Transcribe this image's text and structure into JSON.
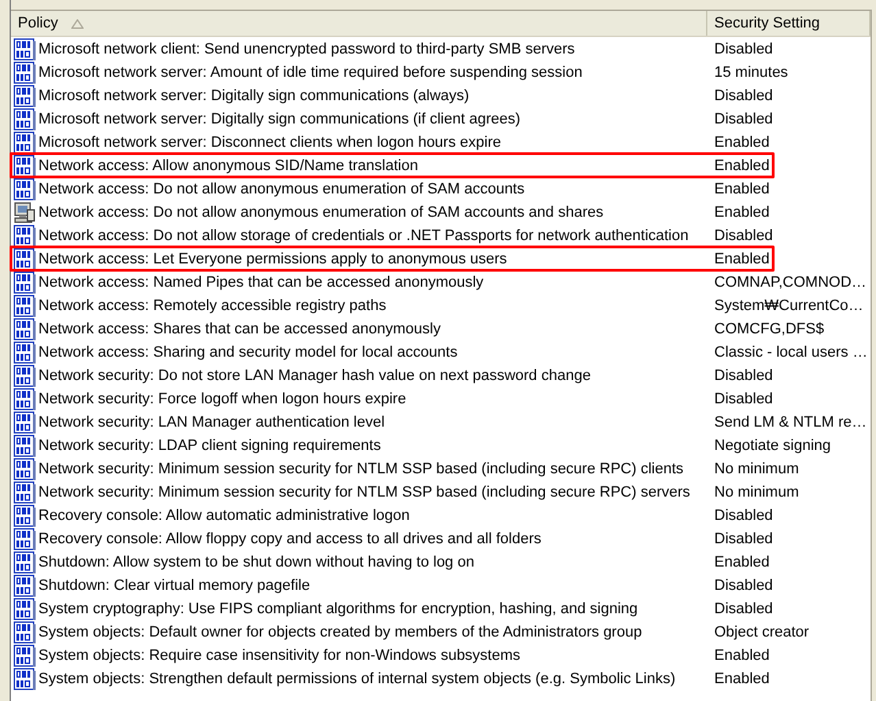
{
  "table": {
    "columns": [
      {
        "label": "Policy",
        "sorted": true
      },
      {
        "label": "Security Setting",
        "sorted": false
      }
    ],
    "rows": [
      {
        "policy": "Microsoft network client: Send unencrypted password to third-party SMB servers",
        "setting": "Disabled",
        "kind": "binary",
        "highlighted": false
      },
      {
        "policy": "Microsoft network server: Amount of idle time required before suspending session",
        "setting": "15 minutes",
        "kind": "binary",
        "highlighted": false
      },
      {
        "policy": "Microsoft network server: Digitally sign communications (always)",
        "setting": "Disabled",
        "kind": "binary",
        "highlighted": false
      },
      {
        "policy": "Microsoft network server: Digitally sign communications (if client agrees)",
        "setting": "Disabled",
        "kind": "binary",
        "highlighted": false
      },
      {
        "policy": "Microsoft network server: Disconnect clients when logon hours expire",
        "setting": "Enabled",
        "kind": "binary",
        "highlighted": false
      },
      {
        "policy": "Network access: Allow anonymous SID/Name translation",
        "setting": "Enabled",
        "kind": "binary",
        "highlighted": true
      },
      {
        "policy": "Network access: Do not allow anonymous enumeration of SAM accounts",
        "setting": "Enabled",
        "kind": "binary",
        "highlighted": false
      },
      {
        "policy": "Network access: Do not allow anonymous enumeration of SAM accounts and shares",
        "setting": "Enabled",
        "kind": "computer",
        "highlighted": false
      },
      {
        "policy": "Network access: Do not allow storage of credentials or .NET Passports for network authentication",
        "setting": "Disabled",
        "kind": "binary",
        "highlighted": false
      },
      {
        "policy": "Network access: Let Everyone permissions apply to anonymous users",
        "setting": "Enabled",
        "kind": "binary",
        "highlighted": true
      },
      {
        "policy": "Network access: Named Pipes that can be accessed anonymously",
        "setting": "COMNAP,COMNOD…",
        "kind": "binary",
        "highlighted": false
      },
      {
        "policy": "Network access: Remotely accessible registry paths",
        "setting": "System₩CurrentCo…",
        "kind": "binary",
        "highlighted": false
      },
      {
        "policy": "Network access: Shares that can be accessed anonymously",
        "setting": "COMCFG,DFS$",
        "kind": "binary",
        "highlighted": false
      },
      {
        "policy": "Network access: Sharing and security model for local accounts",
        "setting": "Classic - local users …",
        "kind": "binary",
        "highlighted": false
      },
      {
        "policy": "Network security: Do not store LAN Manager hash value on next password change",
        "setting": "Disabled",
        "kind": "binary",
        "highlighted": false
      },
      {
        "policy": "Network security: Force logoff when logon hours expire",
        "setting": "Disabled",
        "kind": "binary",
        "highlighted": false
      },
      {
        "policy": "Network security: LAN Manager authentication level",
        "setting": "Send LM & NTLM re…",
        "kind": "binary",
        "highlighted": false
      },
      {
        "policy": "Network security: LDAP client signing requirements",
        "setting": "Negotiate signing",
        "kind": "binary",
        "highlighted": false
      },
      {
        "policy": "Network security: Minimum session security for NTLM SSP based (including secure RPC) clients",
        "setting": "No minimum",
        "kind": "binary",
        "highlighted": false
      },
      {
        "policy": "Network security: Minimum session security for NTLM SSP based (including secure RPC) servers",
        "setting": "No minimum",
        "kind": "binary",
        "highlighted": false
      },
      {
        "policy": "Recovery console: Allow automatic administrative logon",
        "setting": "Disabled",
        "kind": "binary",
        "highlighted": false
      },
      {
        "policy": "Recovery console: Allow floppy copy and access to all drives and all folders",
        "setting": "Disabled",
        "kind": "binary",
        "highlighted": false
      },
      {
        "policy": "Shutdown: Allow system to be shut down without having to log on",
        "setting": "Enabled",
        "kind": "binary",
        "highlighted": false
      },
      {
        "policy": "Shutdown: Clear virtual memory pagefile",
        "setting": "Disabled",
        "kind": "binary",
        "highlighted": false
      },
      {
        "policy": "System cryptography: Use FIPS compliant algorithms for encryption, hashing, and signing",
        "setting": "Disabled",
        "kind": "binary",
        "highlighted": false
      },
      {
        "policy": "System objects: Default owner for objects created by members of the Administrators group",
        "setting": "Object creator",
        "kind": "binary",
        "highlighted": false
      },
      {
        "policy": "System objects: Require case insensitivity for non-Windows subsystems",
        "setting": "Enabled",
        "kind": "binary",
        "highlighted": false
      },
      {
        "policy": "System objects: Strengthen default permissions of internal system objects (e.g. Symbolic Links)",
        "setting": "Enabled",
        "kind": "binary",
        "highlighted": false
      }
    ]
  }
}
